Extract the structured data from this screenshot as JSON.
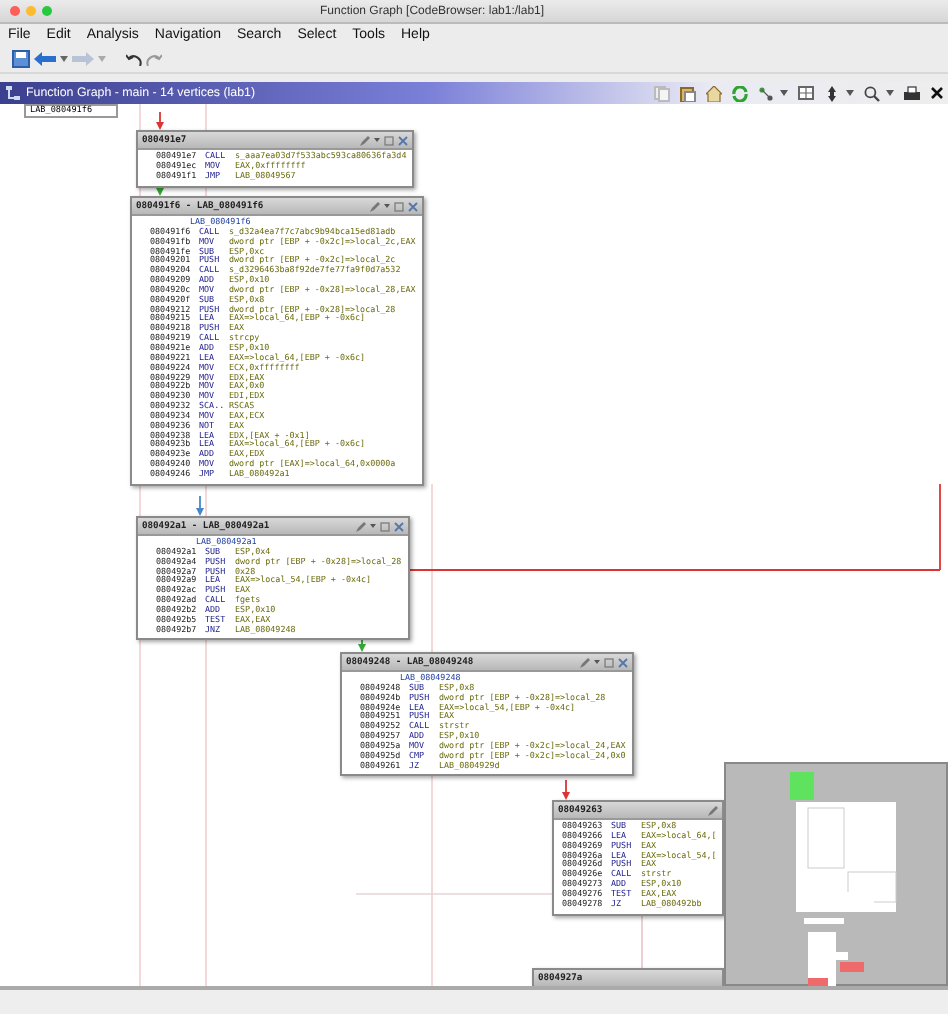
{
  "window": {
    "title": "Function Graph [CodeBrowser: lab1:/lab1]"
  },
  "menu": [
    "File",
    "Edit",
    "Analysis",
    "Navigation",
    "Search",
    "Select",
    "Tools",
    "Help"
  ],
  "panel": {
    "title": "Function Graph - main - 14 vertices  (lab1)"
  },
  "graph": {
    "top_label": "LAB_080491f6",
    "blocks": [
      {
        "title": "080491e7",
        "lines": [
          {
            "kind": "instruction",
            "address": "080491e7",
            "mnemonic": "CALL",
            "operands": "s_aaa7ea03d7f533abc593ca80636fa3d4"
          },
          {
            "kind": "instruction",
            "address": "080491ec",
            "mnemonic": "MOV",
            "operands": "EAX,0xffffffff"
          },
          {
            "kind": "instruction",
            "address": "080491f1",
            "mnemonic": "JMP",
            "operands": "LAB_08049567"
          }
        ]
      },
      {
        "title": "080491f6 - LAB_080491f6",
        "lines": [
          {
            "kind": "label",
            "text": "LAB_080491f6"
          },
          {
            "kind": "instruction",
            "address": "080491f6",
            "mnemonic": "CALL",
            "operands": "s_d32a4ea7f7c7abc9b94bca15ed81adb"
          },
          {
            "kind": "instruction",
            "address": "080491fb",
            "mnemonic": "MOV",
            "operands": "dword ptr [EBP + -0x2c]=>local_2c,EAX"
          },
          {
            "kind": "instruction",
            "address": "080491fe",
            "mnemonic": "SUB",
            "operands": "ESP,0xc"
          },
          {
            "kind": "instruction",
            "address": "08049201",
            "mnemonic": "PUSH",
            "operands": "dword ptr [EBP + -0x2c]=>local_2c"
          },
          {
            "kind": "instruction",
            "address": "08049204",
            "mnemonic": "CALL",
            "operands": "s_d3296463ba8f92de7fe77fa9f0d7a532"
          },
          {
            "kind": "instruction",
            "address": "08049209",
            "mnemonic": "ADD",
            "operands": "ESP,0x10"
          },
          {
            "kind": "instruction",
            "address": "0804920c",
            "mnemonic": "MOV",
            "operands": "dword ptr [EBP + -0x28]=>local_28,EAX"
          },
          {
            "kind": "instruction",
            "address": "0804920f",
            "mnemonic": "SUB",
            "operands": "ESP,0x8"
          },
          {
            "kind": "instruction",
            "address": "08049212",
            "mnemonic": "PUSH",
            "operands": "dword ptr [EBP + -0x28]=>local_28"
          },
          {
            "kind": "instruction",
            "address": "08049215",
            "mnemonic": "LEA",
            "operands": "EAX=>local_64,[EBP + -0x6c]"
          },
          {
            "kind": "instruction",
            "address": "08049218",
            "mnemonic": "PUSH",
            "operands": "EAX"
          },
          {
            "kind": "instruction",
            "address": "08049219",
            "mnemonic": "CALL",
            "operands": "strcpy"
          },
          {
            "kind": "instruction",
            "address": "0804921e",
            "mnemonic": "ADD",
            "operands": "ESP,0x10"
          },
          {
            "kind": "instruction",
            "address": "08049221",
            "mnemonic": "LEA",
            "operands": "EAX=>local_64,[EBP + -0x6c]"
          },
          {
            "kind": "instruction",
            "address": "08049224",
            "mnemonic": "MOV",
            "operands": "ECX,0xffffffff"
          },
          {
            "kind": "instruction",
            "address": "08049229",
            "mnemonic": "MOV",
            "operands": "EDX,EAX"
          },
          {
            "kind": "instruction",
            "address": "0804922b",
            "mnemonic": "MOV",
            "operands": "EAX,0x0"
          },
          {
            "kind": "instruction",
            "address": "08049230",
            "mnemonic": "MOV",
            "operands": "EDI,EDX"
          },
          {
            "kind": "instruction",
            "address": "08049232",
            "mnemonic": "SCA..",
            "operands": "RSCAS"
          },
          {
            "kind": "instruction",
            "address": "08049234",
            "mnemonic": "MOV",
            "operands": "EAX,ECX"
          },
          {
            "kind": "instruction",
            "address": "08049236",
            "mnemonic": "NOT",
            "operands": "EAX"
          },
          {
            "kind": "instruction",
            "address": "08049238",
            "mnemonic": "LEA",
            "operands": "EDX,[EAX + -0x1]"
          },
          {
            "kind": "instruction",
            "address": "0804923b",
            "mnemonic": "LEA",
            "operands": "EAX=>local_64,[EBP + -0x6c]"
          },
          {
            "kind": "instruction",
            "address": "0804923e",
            "mnemonic": "ADD",
            "operands": "EAX,EDX"
          },
          {
            "kind": "instruction",
            "address": "08049240",
            "mnemonic": "MOV",
            "operands": "dword ptr [EAX]=>local_64,0x0000a"
          },
          {
            "kind": "instruction",
            "address": "08049246",
            "mnemonic": "JMP",
            "operands": "LAB_080492a1"
          }
        ]
      },
      {
        "title": "080492a1 - LAB_080492a1",
        "lines": [
          {
            "kind": "label",
            "text": "LAB_080492a1"
          },
          {
            "kind": "instruction",
            "address": "080492a1",
            "mnemonic": "SUB",
            "operands": "ESP,0x4"
          },
          {
            "kind": "instruction",
            "address": "080492a4",
            "mnemonic": "PUSH",
            "operands": "dword ptr [EBP + -0x28]=>local_28"
          },
          {
            "kind": "instruction",
            "address": "080492a7",
            "mnemonic": "PUSH",
            "operands": "0x28"
          },
          {
            "kind": "instruction",
            "address": "080492a9",
            "mnemonic": "LEA",
            "operands": "EAX=>local_54,[EBP + -0x4c]"
          },
          {
            "kind": "instruction",
            "address": "080492ac",
            "mnemonic": "PUSH",
            "operands": "EAX"
          },
          {
            "kind": "instruction",
            "address": "080492ad",
            "mnemonic": "CALL",
            "operands": "fgets"
          },
          {
            "kind": "instruction",
            "address": "080492b2",
            "mnemonic": "ADD",
            "operands": "ESP,0x10"
          },
          {
            "kind": "instruction",
            "address": "080492b5",
            "mnemonic": "TEST",
            "operands": "EAX,EAX"
          },
          {
            "kind": "instruction",
            "address": "080492b7",
            "mnemonic": "JNZ",
            "operands": "LAB_08049248"
          }
        ]
      },
      {
        "title": "08049248 - LAB_08049248",
        "lines": [
          {
            "kind": "label",
            "text": "LAB_08049248"
          },
          {
            "kind": "instruction",
            "address": "08049248",
            "mnemonic": "SUB",
            "operands": "ESP,0x8"
          },
          {
            "kind": "instruction",
            "address": "0804924b",
            "mnemonic": "PUSH",
            "operands": "dword ptr [EBP + -0x28]=>local_28"
          },
          {
            "kind": "instruction",
            "address": "0804924e",
            "mnemonic": "LEA",
            "operands": "EAX=>local_54,[EBP + -0x4c]"
          },
          {
            "kind": "instruction",
            "address": "08049251",
            "mnemonic": "PUSH",
            "operands": "EAX"
          },
          {
            "kind": "instruction",
            "address": "08049252",
            "mnemonic": "CALL",
            "operands": "strstr"
          },
          {
            "kind": "instruction",
            "address": "08049257",
            "mnemonic": "ADD",
            "operands": "ESP,0x10"
          },
          {
            "kind": "instruction",
            "address": "0804925a",
            "mnemonic": "MOV",
            "operands": "dword ptr [EBP + -0x2c]=>local_24,EAX"
          },
          {
            "kind": "instruction",
            "address": "0804925d",
            "mnemonic": "CMP",
            "operands": "dword ptr [EBP + -0x2c]=>local_24,0x0"
          },
          {
            "kind": "instruction",
            "address": "08049261",
            "mnemonic": "JZ",
            "operands": "LAB_0804929d"
          }
        ]
      },
      {
        "title": "08049263",
        "lines": [
          {
            "kind": "instruction",
            "address": "08049263",
            "mnemonic": "SUB",
            "operands": "ESP,0x8"
          },
          {
            "kind": "instruction",
            "address": "08049266",
            "mnemonic": "LEA",
            "operands": "EAX=>local_64,["
          },
          {
            "kind": "instruction",
            "address": "08049269",
            "mnemonic": "PUSH",
            "operands": "EAX"
          },
          {
            "kind": "instruction",
            "address": "0804926a",
            "mnemonic": "LEA",
            "operands": "EAX=>local_54,["
          },
          {
            "kind": "instruction",
            "address": "0804926d",
            "mnemonic": "PUSH",
            "operands": "EAX"
          },
          {
            "kind": "instruction",
            "address": "0804926e",
            "mnemonic": "CALL",
            "operands": "strstr"
          },
          {
            "kind": "instruction",
            "address": "08049273",
            "mnemonic": "ADD",
            "operands": "ESP,0x10"
          },
          {
            "kind": "instruction",
            "address": "08049276",
            "mnemonic": "TEST",
            "operands": "EAX,EAX"
          },
          {
            "kind": "instruction",
            "address": "08049278",
            "mnemonic": "JZ",
            "operands": "LAB_080492bb"
          }
        ]
      },
      {
        "title": "0804927a"
      }
    ]
  }
}
